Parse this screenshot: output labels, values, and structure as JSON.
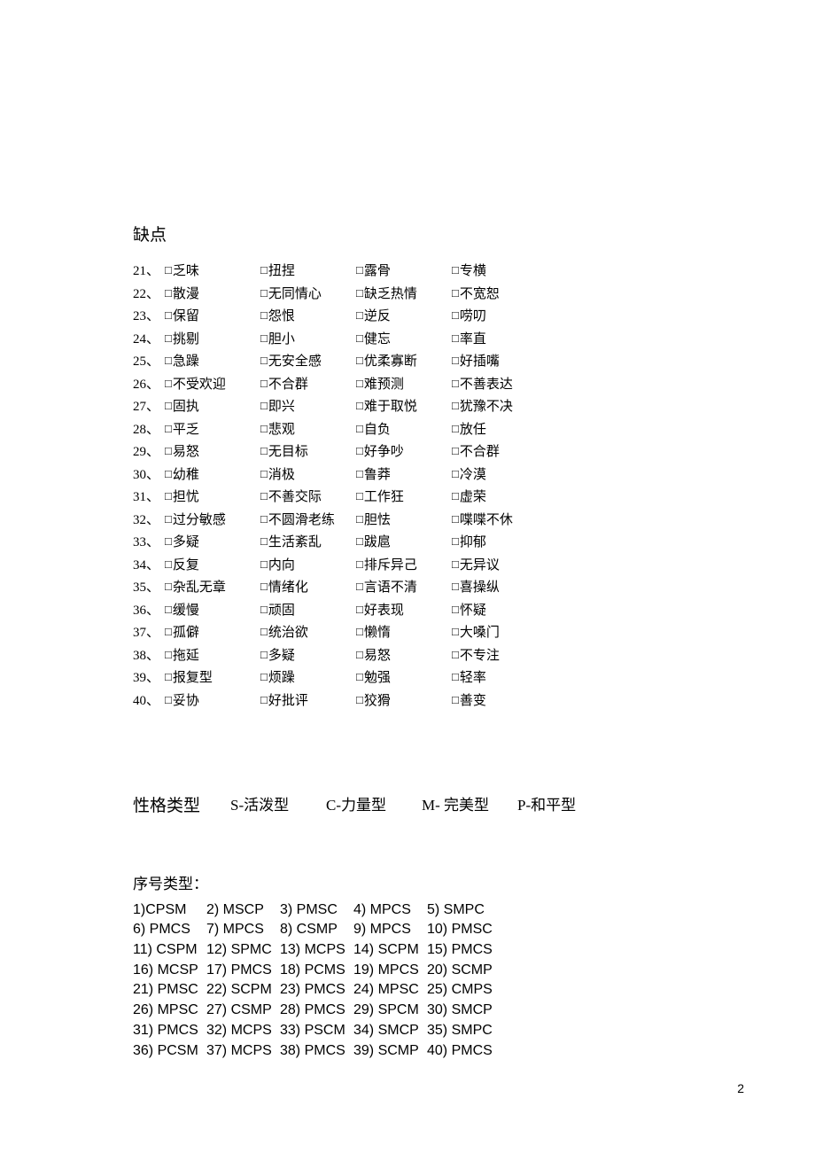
{
  "section_title": "缺点",
  "checkbox_glyph": "□",
  "rows": [
    {
      "n": "21、",
      "c": [
        "乏味",
        "扭捏",
        "露骨",
        "专横"
      ]
    },
    {
      "n": "22、",
      "c": [
        "散漫",
        "无同情心",
        "缺乏热情",
        "不宽恕"
      ]
    },
    {
      "n": "23、",
      "c": [
        "保留",
        "怨恨",
        "逆反",
        "唠叨"
      ]
    },
    {
      "n": "24、",
      "c": [
        "挑剔",
        "胆小",
        "健忘",
        "率直"
      ]
    },
    {
      "n": "25、",
      "c": [
        "急躁",
        "无安全感",
        "优柔寡断",
        "好插嘴"
      ]
    },
    {
      "n": "26、",
      "c": [
        "不受欢迎",
        "不合群",
        "难预测",
        "不善表达"
      ]
    },
    {
      "n": "27、",
      "c": [
        "固执",
        "即兴",
        "难于取悦",
        "犹豫不决"
      ]
    },
    {
      "n": "28、",
      "c": [
        "平乏",
        "悲观",
        "自负",
        "放任"
      ]
    },
    {
      "n": "29、",
      "c": [
        "易怒",
        "无目标",
        "好争吵",
        "不合群"
      ]
    },
    {
      "n": "30、",
      "c": [
        "幼稚",
        "消极",
        "鲁莽",
        "冷漠"
      ]
    },
    {
      "n": "31、",
      "c": [
        "担忧",
        "不善交际",
        "工作狂",
        "虚荣"
      ]
    },
    {
      "n": "32、",
      "c": [
        "过分敏感",
        "不圆滑老练",
        "胆怯",
        "喋喋不休"
      ]
    },
    {
      "n": "33、",
      "c": [
        "多疑",
        "生活紊乱",
        "跋扈",
        "抑郁"
      ]
    },
    {
      "n": "34、",
      "c": [
        "反复",
        "内向",
        "排斥异己",
        "无异议"
      ]
    },
    {
      "n": "35、",
      "c": [
        "杂乱无章",
        "情绪化",
        "言语不清",
        "喜操纵"
      ]
    },
    {
      "n": "36、",
      "c": [
        "缓慢",
        "顽固",
        "好表现",
        "怀疑"
      ]
    },
    {
      "n": "37、",
      "c": [
        "孤僻",
        "统治欲",
        "懒惰",
        "大嗓门"
      ]
    },
    {
      "n": "38、",
      "c": [
        "拖延",
        "多疑",
        "易怒",
        "不专注"
      ]
    },
    {
      "n": "39、",
      "c": [
        "报复型",
        "烦躁",
        "勉强",
        "轻率"
      ]
    },
    {
      "n": "40、",
      "c": [
        "妥协",
        "好批评",
        "狡猾",
        "善变"
      ]
    }
  ],
  "types": {
    "label": "性格类型",
    "items": [
      "S-活泼型",
      "C-力量型",
      "M- 完美型",
      "P-和平型"
    ]
  },
  "seq": {
    "title": "序号类型：",
    "cells": [
      [
        "1)CPSM",
        "2) MSCP",
        "3) PMSC",
        "4) MPCS",
        "5) SMPC"
      ],
      [
        "6) PMCS",
        "7) MPCS",
        "8) CSMP",
        "9) MPCS",
        "10) PMSC"
      ],
      [
        "11) CSPM",
        "12) SPMC",
        "13) MCPS",
        "14) SCPM",
        "15) PMCS"
      ],
      [
        "16) MCSP",
        "17) PMCS",
        "18) PCMS",
        "19) MPCS",
        "20)  SCMP"
      ],
      [
        "21) PMSC",
        "22) SCPM",
        "23) PMCS",
        "24) MPSC",
        "25) CMPS"
      ],
      [
        "26) MPSC",
        "27) CSMP",
        "28) PMCS",
        "29) SPCM",
        "30)  SMCP"
      ],
      [
        "31) PMCS",
        "32) MCPS",
        "33) PSCM",
        "34) SMCP",
        "35)  SMPC"
      ],
      [
        "36) PCSM",
        "37) MCPS",
        "38) PMCS",
        "39) SCMP",
        "40)  PMCS"
      ]
    ]
  },
  "page_number": "2"
}
